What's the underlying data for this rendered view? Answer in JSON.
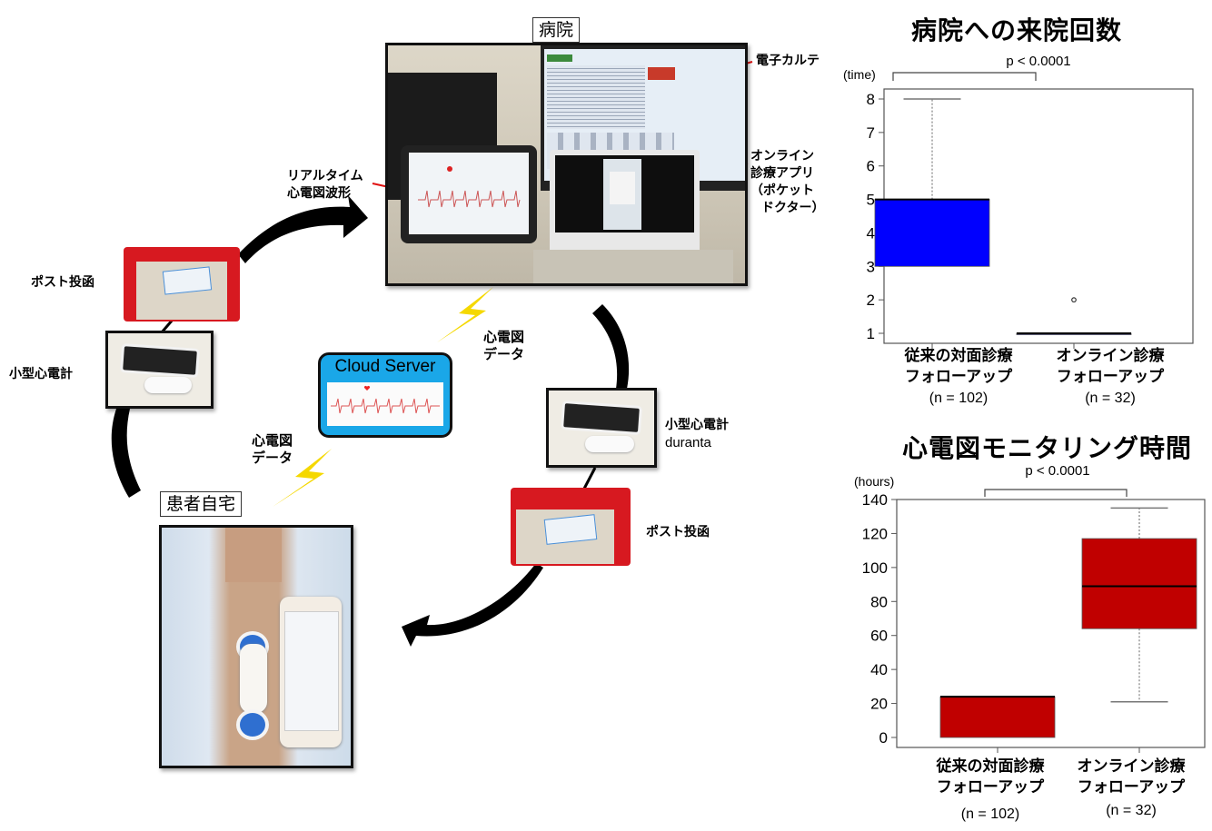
{
  "diagram": {
    "hospital_label": "病院",
    "home_label": "患者自宅",
    "emr_label": "電子カルテ",
    "online_app_label": [
      "オンライン",
      "診療アプリ",
      "（ポケット",
      "ドクター）"
    ],
    "realtime_label": [
      "リアルタイム",
      "心電図波形"
    ],
    "left_post_label": "ポスト投函",
    "left_ecg_label": "小型心電計",
    "right_ecg_label": [
      "小型心電計",
      "duranta"
    ],
    "right_post_label": "ポスト投函",
    "ecg_data_label_upper": [
      "心電図",
      "データ"
    ],
    "ecg_data_label_lower": [
      "心電図",
      "データ"
    ],
    "cloud_server_label": "Cloud Server",
    "colors": {
      "lightning": "#f5d800",
      "cloud_bg": "#1aa7e8",
      "arrow_red": "#e01010",
      "post_red": "#d71920"
    }
  },
  "chart_data": [
    {
      "type": "boxplot",
      "title": "病院への来院回数",
      "ylabel": "(time)",
      "ylim": [
        1,
        8
      ],
      "yticks": [
        "1",
        "2",
        "3",
        "4",
        "5",
        "6",
        "7",
        "8"
      ],
      "p_value": "p < 0.0001",
      "box_color": "#0000ff",
      "categories": [
        {
          "label": [
            "従来の対面診療",
            "フォローアップ"
          ],
          "n": "(n = 102)"
        },
        {
          "label": [
            "オンライン診療",
            "フォローアップ"
          ],
          "n": "(n = 32)"
        }
      ],
      "series": [
        {
          "name": "従来の対面診療フォローアップ",
          "whisker_low": 3,
          "q1": 3,
          "median": 5,
          "q3": 5,
          "whisker_high": 8,
          "outliers": []
        },
        {
          "name": "オンライン診療フォローアップ",
          "whisker_low": 1,
          "q1": 1,
          "median": 1,
          "q3": 1,
          "whisker_high": 1,
          "outliers": [
            2
          ]
        }
      ]
    },
    {
      "type": "boxplot",
      "title": "心電図モニタリング時間",
      "ylabel": "(hours)",
      "ylim": [
        0,
        140
      ],
      "yticks": [
        "0",
        "20",
        "40",
        "60",
        "80",
        "100",
        "120",
        "140"
      ],
      "p_value": "p < 0.0001",
      "box_color": "#c00000",
      "categories": [
        {
          "label": [
            "従来の対面診療",
            "フォローアップ"
          ],
          "n": "(n = 102)"
        },
        {
          "label": [
            "オンライン診療",
            "フォローアップ"
          ],
          "n": "(n = 32)"
        }
      ],
      "series": [
        {
          "name": "従来の対面診療フォローアップ",
          "whisker_low": 0,
          "q1": 0,
          "median": 24,
          "q3": 24,
          "whisker_high": 24,
          "outliers": []
        },
        {
          "name": "オンライン診療フォローアップ",
          "whisker_low": 21,
          "q1": 64,
          "median": 89,
          "q3": 117,
          "whisker_high": 135,
          "outliers": []
        }
      ]
    }
  ]
}
